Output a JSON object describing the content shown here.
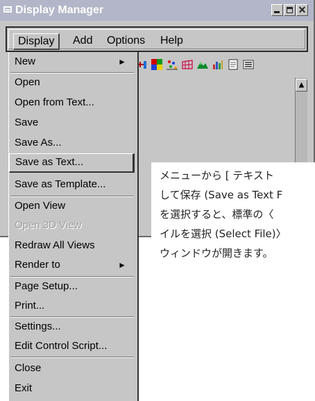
{
  "window": {
    "title": "Display Manager"
  },
  "menubar": {
    "items": [
      "Display",
      "Add",
      "Options",
      "Help"
    ]
  },
  "toolbar": {
    "icons": [
      "add-view-icon",
      "color-map-icon",
      "scatter-plot-icon",
      "surface-grid-icon",
      "terrain-icon",
      "histogram-icon",
      "document-icon",
      "list-view-icon"
    ]
  },
  "view": {
    "edge_label": "["
  },
  "dropdown": {
    "items": [
      {
        "label": "New"
      },
      {
        "label": "Open"
      },
      {
        "label": "Open from Text..."
      },
      {
        "label": "Save"
      },
      {
        "label": "Save As..."
      },
      {
        "label": "Save as Text..."
      },
      {
        "label": "Save as Template..."
      },
      {
        "label": "Open View"
      },
      {
        "label": "Open 3D View"
      },
      {
        "label": "Redraw All Views"
      },
      {
        "label": "Render to"
      },
      {
        "label": "Page Setup..."
      },
      {
        "label": "Print..."
      },
      {
        "label": "Settings..."
      },
      {
        "label": "Edit Control Script..."
      },
      {
        "label": "Close"
      },
      {
        "label": "Exit"
      }
    ]
  },
  "caption": {
    "lines": [
      "メニューから [ テキスト",
      "して保存 (Save as Text F",
      "を選択すると、標準の〈",
      "イルを選択 (Select File)〉",
      "ウィンドウが開きます。"
    ]
  },
  "colors": {
    "titlebar": "#b2b6c8",
    "window": "#c6c6c6",
    "caption_text": "#222222"
  }
}
